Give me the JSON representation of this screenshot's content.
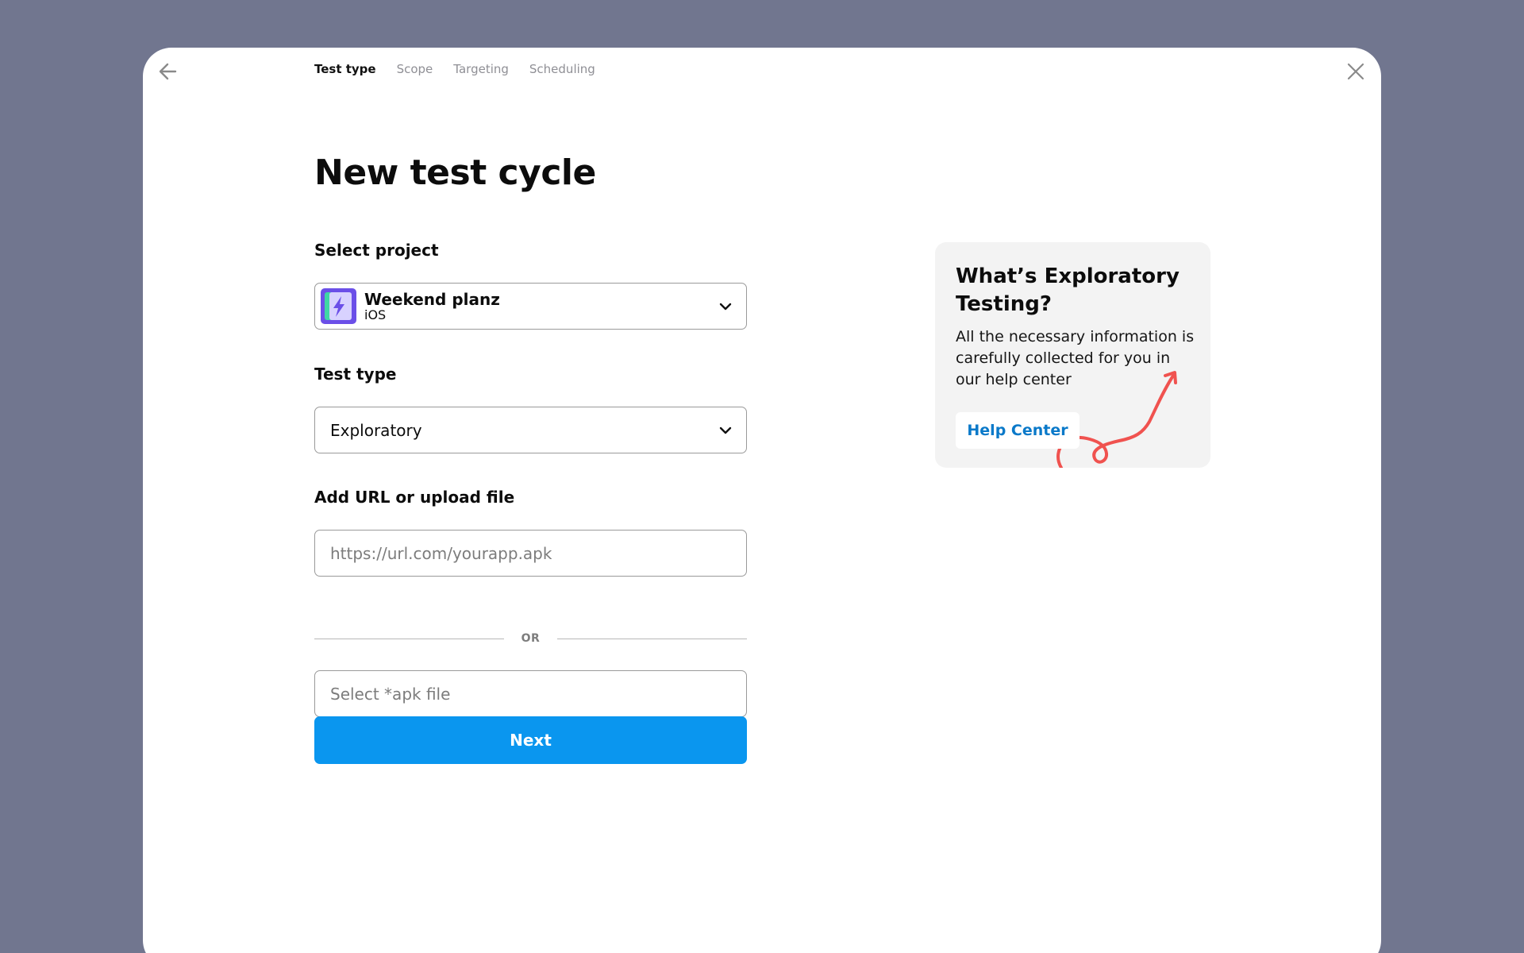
{
  "nav": {
    "back_icon": "arrow-left-icon",
    "close_icon": "close-icon",
    "steps": [
      {
        "label": "Test type",
        "active": true
      },
      {
        "label": "Scope",
        "active": false
      },
      {
        "label": "Targeting",
        "active": false
      },
      {
        "label": "Scheduling",
        "active": false
      }
    ]
  },
  "page": {
    "title": "New test cycle"
  },
  "form": {
    "project": {
      "label": "Select project",
      "name": "Weekend planz",
      "platform": "iOS",
      "icon": "app-lightning-icon"
    },
    "test_type": {
      "label": "Test type",
      "value": "Exploratory"
    },
    "upload": {
      "label": "Add URL or upload file",
      "url_placeholder": "https://url.com/yourapp.apk",
      "or_text": "OR",
      "file_placeholder": "Select *apk file"
    },
    "next_label": "Next"
  },
  "info_card": {
    "title": "What’s Exploratory Testing?",
    "body": "All the necessary information is carefully collected for you in our help center",
    "button_label": "Help Center",
    "decoration": "squiggle-arrow-icon"
  },
  "colors": {
    "backdrop": "#71768f",
    "primary": "#0a96ef",
    "link": "#0a79c9",
    "squiggle": "#f0524f",
    "card_bg": "#f3f3f3"
  }
}
